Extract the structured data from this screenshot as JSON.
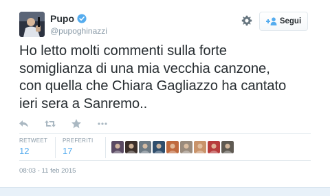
{
  "tweet": {
    "user": {
      "display_name": "Pupo",
      "handle": "@pupoghinazzi",
      "verified": true
    },
    "follow_label": "Segui",
    "text_lines": [
      "Ho letto molti commenti sulla forte",
      "somiglianza di una mia vecchia canzone,",
      "con quella che Chiara Gagliazzo ha cantato",
      "ieri sera a Sanremo.."
    ],
    "stats": {
      "retweet_label": "RETWEET",
      "retweet_count": "12",
      "favorites_label": "PREFERITI",
      "favorites_count": "17"
    },
    "timestamp": "08:03 - 11 feb 2015"
  },
  "icons": {
    "verified": "verified-check-icon",
    "settings": "gear-icon",
    "follow": "add-user-icon",
    "reply": "reply-icon",
    "retweet": "retweet-icon",
    "favorite": "star-icon",
    "more": "more-dots-icon"
  },
  "colors": {
    "link_blue": "#55acee",
    "text": "#292f33",
    "muted": "#8899a6",
    "border": "#e1e8ed",
    "verified": "#55acee"
  },
  "favoriters": [
    {
      "name": "favoriter-1",
      "color": "#5a4a63"
    },
    {
      "name": "favoriter-2",
      "color": "#3b2f2a"
    },
    {
      "name": "favoriter-3",
      "color": "#6d7a84"
    },
    {
      "name": "favoriter-4",
      "color": "#2f4e6c"
    },
    {
      "name": "favoriter-5",
      "color": "#c06a3e"
    },
    {
      "name": "favoriter-6",
      "color": "#9a8b7d"
    },
    {
      "name": "favoriter-7",
      "color": "#c9936a"
    },
    {
      "name": "favoriter-8",
      "color": "#b73c3c"
    },
    {
      "name": "favoriter-9",
      "color": "#5f5a52"
    }
  ]
}
